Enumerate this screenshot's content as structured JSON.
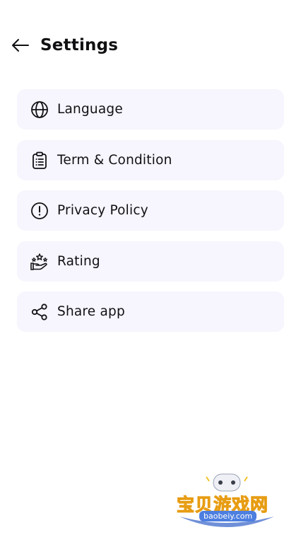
{
  "header": {
    "title": "Settings",
    "back_icon": "arrow-left-icon"
  },
  "menu": {
    "items": [
      {
        "label": "Language",
        "icon": "globe-icon"
      },
      {
        "label": "Term & Condition",
        "icon": "clipboard-list-icon"
      },
      {
        "label": "Privacy Policy",
        "icon": "exclamation-circle-icon"
      },
      {
        "label": "Rating",
        "icon": "hand-stars-icon"
      },
      {
        "label": "Share app",
        "icon": "share-icon"
      }
    ]
  },
  "watermark": {
    "text": "宝贝游戏网",
    "url": "baobeiy.com"
  },
  "colors": {
    "item_background": "#f7f5fd",
    "text": "#111114",
    "background": "#ffffff"
  }
}
